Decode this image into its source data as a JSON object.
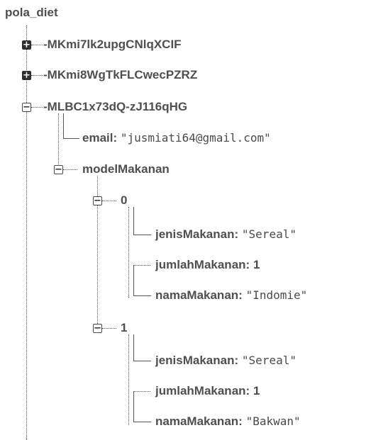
{
  "root": {
    "label": "pola_diet"
  },
  "children": [
    {
      "key": "-MKmi7lk2upgCNlqXCIF",
      "state": "collapsed"
    },
    {
      "key": "-MKmi8WgTkFLCwecPZRZ",
      "state": "collapsed"
    },
    {
      "key": "-MLBC1x73dQ-zJ116qHG",
      "state": "expanded"
    }
  ],
  "record": {
    "email": {
      "key": "email",
      "sep": ":",
      "value": "\"jusmiati64@gmail.com\""
    },
    "modelMakanan": {
      "key": "modelMakanan",
      "items": [
        {
          "index": "0",
          "fields": [
            {
              "key": "jenisMakanan",
              "sep": ":",
              "value": "\"Sereal\"",
              "kind": "string"
            },
            {
              "key": "jumlahMakanan",
              "sep": ":",
              "value": "1",
              "kind": "number"
            },
            {
              "key": "namaMakanan",
              "sep": ":",
              "value": "\"Indomie\"",
              "kind": "string"
            }
          ]
        },
        {
          "index": "1",
          "fields": [
            {
              "key": "jenisMakanan",
              "sep": ":",
              "value": "\"Sereal\"",
              "kind": "string"
            },
            {
              "key": "jumlahMakanan",
              "sep": ":",
              "value": "1",
              "kind": "number"
            },
            {
              "key": "namaMakanan",
              "sep": ":",
              "value": "\"Bakwan\"",
              "kind": "string"
            }
          ]
        }
      ]
    }
  },
  "icons": {
    "expand": "plus-icon",
    "collapse": "minus-icon"
  },
  "toggle_glyphs": {
    "plus": "+",
    "minus": "−"
  }
}
